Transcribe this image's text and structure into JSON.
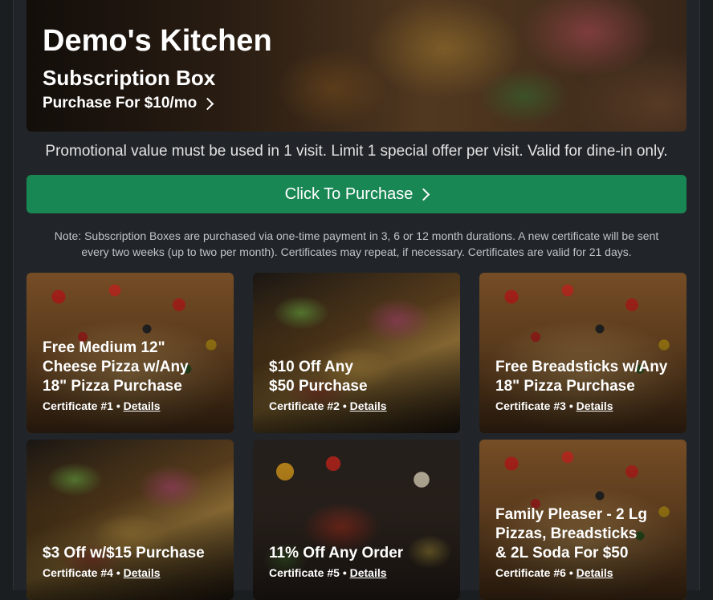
{
  "header": {
    "restaurant_name": "Demo's Kitchen",
    "product_name": "Subscription Box",
    "purchase_link": "Purchase For $10/mo"
  },
  "promo_text": "Promotional value must be used in 1 visit. Limit 1 special offer per visit. Valid for dine-in only.",
  "purchase_button_label": "Click To Purchase",
  "note_text": "Note: Subscription Boxes are purchased via one-time payment in 3, 6 or 12 month durations. A new certificate will be sent every two weeks (up to two per month). Certificates may repeat, if necessary. Certificates are valid for 21 days.",
  "details_label": "Details",
  "certificates": [
    {
      "title": "Free Medium 12\"\nCheese Pizza w/Any\n18\" Pizza Purchase",
      "label": "Certificate #1",
      "image": "pizza"
    },
    {
      "title": "$10 Off Any\n$50 Purchase",
      "label": "Certificate #2",
      "image": "taco"
    },
    {
      "title": "Free Breadsticks w/Any\n18\" Pizza Purchase",
      "label": "Certificate #3",
      "image": "pizza"
    },
    {
      "title": "$3 Off w/$15 Purchase",
      "label": "Certificate #4",
      "image": "taco"
    },
    {
      "title": "11% Off Any Order",
      "label": "Certificate #5",
      "image": "bowl"
    },
    {
      "title": "Family Pleaser - 2 Lg\nPizzas, Breadsticks\n& 2L Soda For $50",
      "label": "Certificate #6",
      "image": "pizza"
    }
  ],
  "colors": {
    "accent": "#198754",
    "background": "#212529"
  }
}
